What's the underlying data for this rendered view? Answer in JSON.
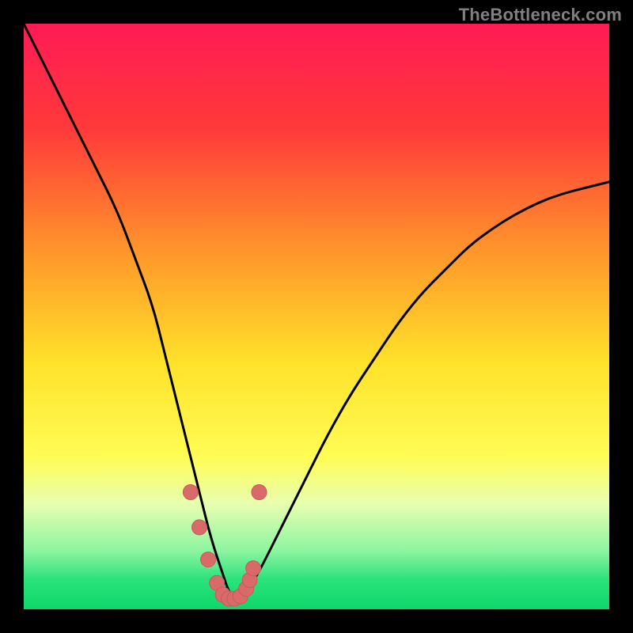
{
  "watermark": "TheBottleneck.com",
  "chart_data": {
    "type": "line",
    "title": "",
    "xlabel": "",
    "ylabel": "",
    "xlim": [
      0,
      100
    ],
    "ylim": [
      0,
      100
    ],
    "gradient_stops": [
      {
        "offset": 0,
        "color": "#ff1a55"
      },
      {
        "offset": 0.18,
        "color": "#ff3a3a"
      },
      {
        "offset": 0.4,
        "color": "#ff9a2a"
      },
      {
        "offset": 0.58,
        "color": "#ffe22a"
      },
      {
        "offset": 0.74,
        "color": "#fffc55"
      },
      {
        "offset": 0.82,
        "color": "#e8ffb0"
      },
      {
        "offset": 0.9,
        "color": "#8cf5a0"
      },
      {
        "offset": 0.95,
        "color": "#29e27a"
      },
      {
        "offset": 1.0,
        "color": "#0fd66a"
      }
    ],
    "series": [
      {
        "name": "curve",
        "x": [
          0,
          4,
          8,
          12,
          16,
          19,
          22,
          24,
          26,
          28,
          30,
          32,
          34,
          35,
          36,
          37,
          38,
          40,
          44,
          48,
          52,
          56,
          60,
          64,
          68,
          72,
          76,
          80,
          84,
          88,
          92,
          96,
          100
        ],
        "y": [
          100,
          92,
          84,
          76,
          68,
          60,
          52,
          44,
          36,
          28,
          20,
          12,
          6,
          3,
          2,
          2,
          3,
          6,
          14,
          22,
          30,
          37,
          43,
          49,
          54,
          58,
          62,
          65,
          67.5,
          69.5,
          71,
          72,
          73
        ]
      },
      {
        "name": "markers",
        "x": [
          28.5,
          30.0,
          31.5,
          33.0,
          34.0,
          35.0,
          36.0,
          37.0,
          38.0,
          38.6,
          39.2,
          40.2
        ],
        "y": [
          20.0,
          14.0,
          8.5,
          4.5,
          2.5,
          1.8,
          1.8,
          2.2,
          3.5,
          5.0,
          7.0,
          20.0
        ]
      }
    ],
    "colors": {
      "curve": "#000000",
      "marker_fill": "#d96a6a",
      "marker_stroke": "#c85a5a",
      "background_frame": "#000000"
    }
  }
}
